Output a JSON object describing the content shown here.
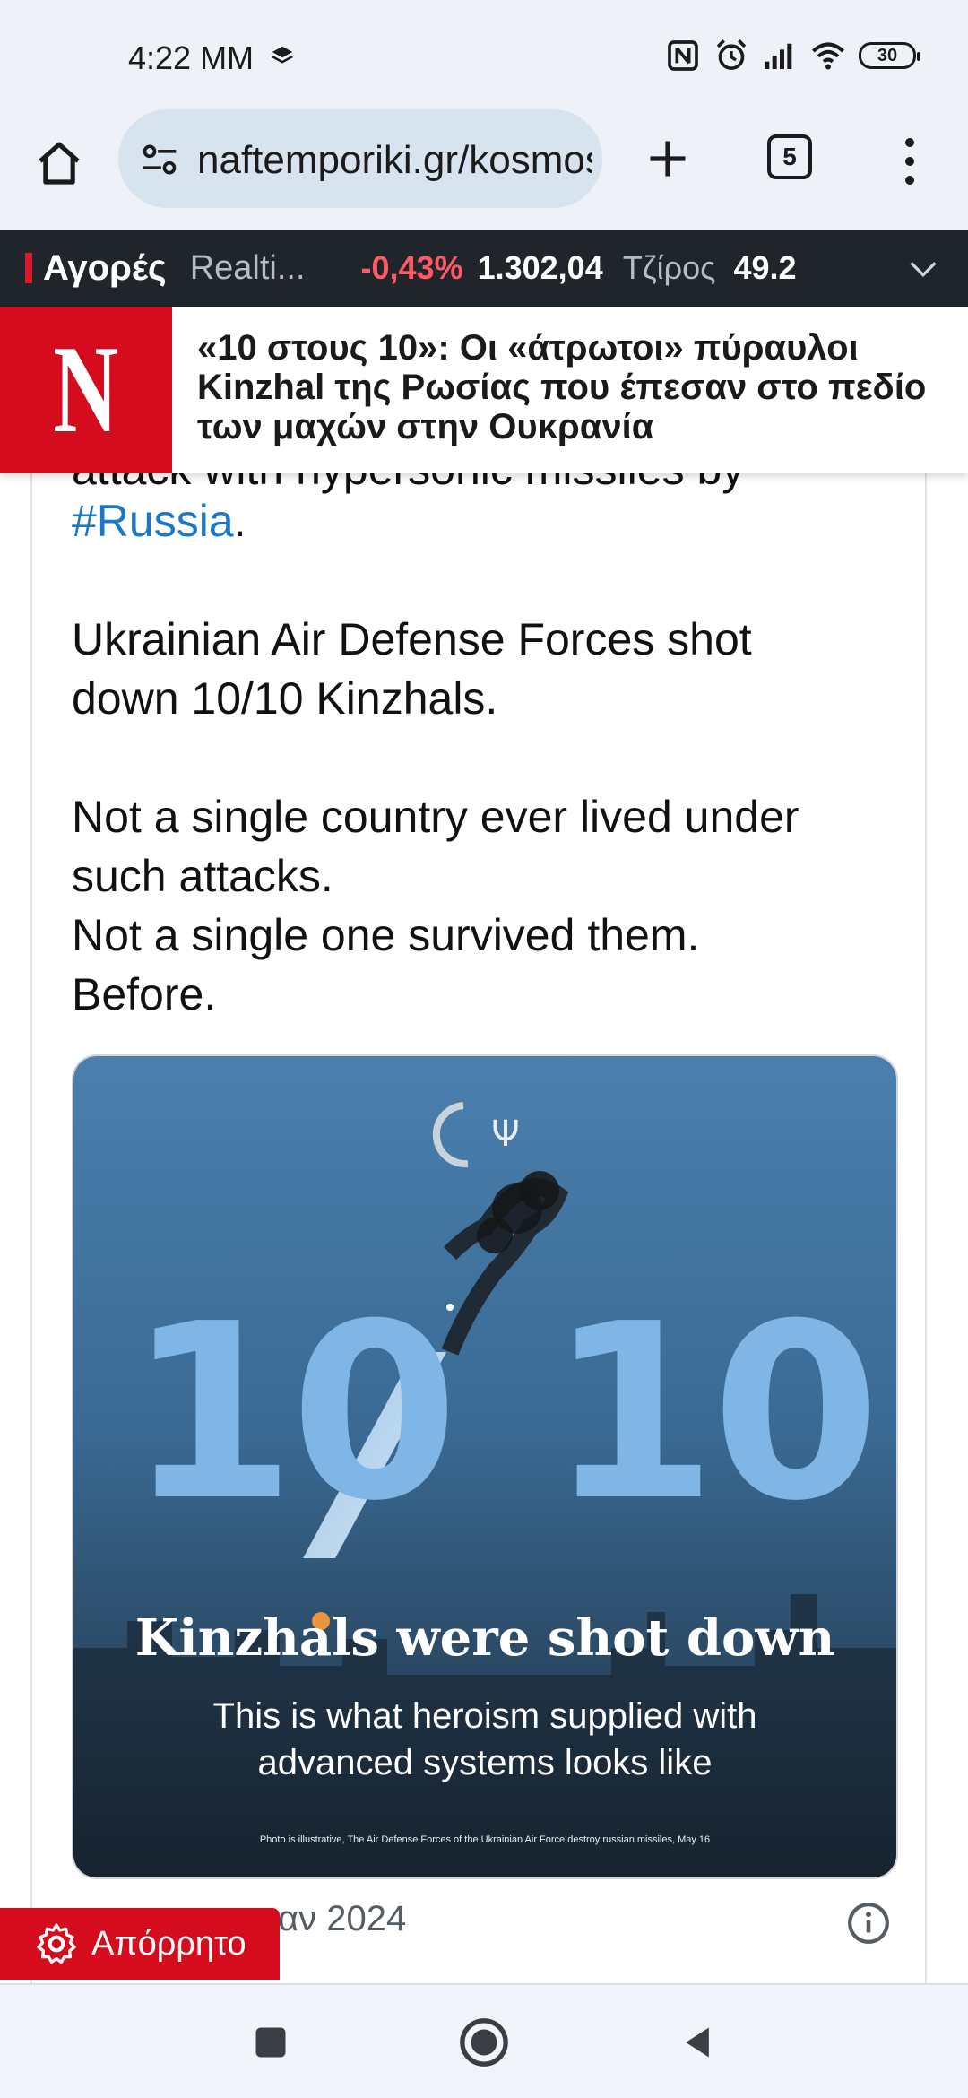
{
  "status_bar": {
    "time": "4:22 MM",
    "battery": "30"
  },
  "browser": {
    "url": "naftemporiki.gr/kosmos",
    "tab_count": "5"
  },
  "ticker": {
    "title": "Αγορές",
    "subtitle": "Realti...",
    "change": "-0,43%",
    "value": "1.302,04",
    "turnover_label": "Τζίρος",
    "turnover": "49.2"
  },
  "article": {
    "brand_letter": "N",
    "title": "«10 στους 10»: Οι «άτρωτοι» πύραυλοι Kinzhal της Ρωσίας που έπεσαν στο πεδίο των μαχών στην Ουκρανία"
  },
  "tweet": {
    "cut_line": "attack with hypersonic missiles by",
    "hashtag": "#Russia",
    "hashtag_suffix": ".",
    "para2_line1": "Ukrainian Air Defense Forces shot",
    "para2_line2": "down 10/10 Kinzhals.",
    "para3_line1": "Not a single country ever lived under",
    "para3_line2": "such attacks.",
    "para3_line3": "Not a single one survived them.",
    "para3_line4": "Before.",
    "date": "αν 2024"
  },
  "tweet_image": {
    "big_left": "10",
    "big_right": "10",
    "heading": "Kinzhals were shot down",
    "sub_line1": "This is what heroism supplied with",
    "sub_line2": "advanced systems looks like",
    "credit": "Photo is illustrative, The Air Defense Forces of the Ukrainian Air Force destroy russian missiles, May 16"
  },
  "privacy": {
    "label": "Απόρρητο"
  },
  "colors": {
    "brand_red": "#d50c1e",
    "hashtag_blue": "#1d77c8",
    "ticker_bg": "#1f252b",
    "negative": "#ff5a63"
  },
  "icons": {
    "home": "home-icon",
    "site_settings": "site-settings-icon",
    "new_tab": "plus-icon",
    "menu": "more-vert-icon",
    "info": "info-icon",
    "gear": "gear-icon"
  }
}
